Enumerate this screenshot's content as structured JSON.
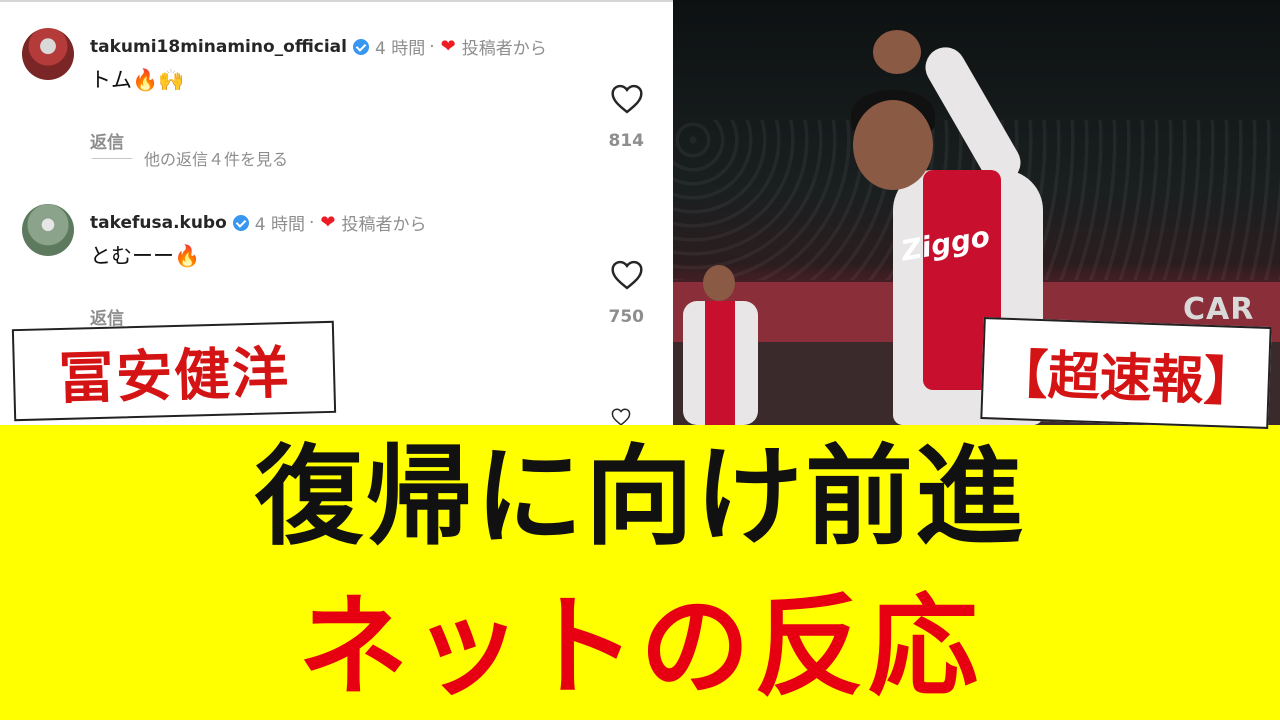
{
  "comments": [
    {
      "username": "takumi18minamino_official",
      "time": "4 時間",
      "separator": "·",
      "from_author": "投稿者から",
      "text": "トム🔥🙌",
      "reply_label": "返信",
      "likes": "814"
    },
    {
      "username": "takefusa.kubo",
      "time": "4 時間",
      "separator": "·",
      "from_author": "投稿者から",
      "text": "とむーー🔥",
      "reply_label": "返信",
      "likes": "750"
    }
  ],
  "more_replies": "他の返信４件を見る",
  "photo": {
    "sponsor": "Ziggo",
    "banner_fragment": "CAR"
  },
  "name_tag": "冨安健洋",
  "breaking_tag": "【超速報】",
  "headline_1": "復帰に向け前進",
  "headline_2": "ネットの反応",
  "colors": {
    "background": "#ffff00",
    "accent_red": "#e60012",
    "tag_red": "#d41414",
    "verified_blue": "#3897f0"
  }
}
